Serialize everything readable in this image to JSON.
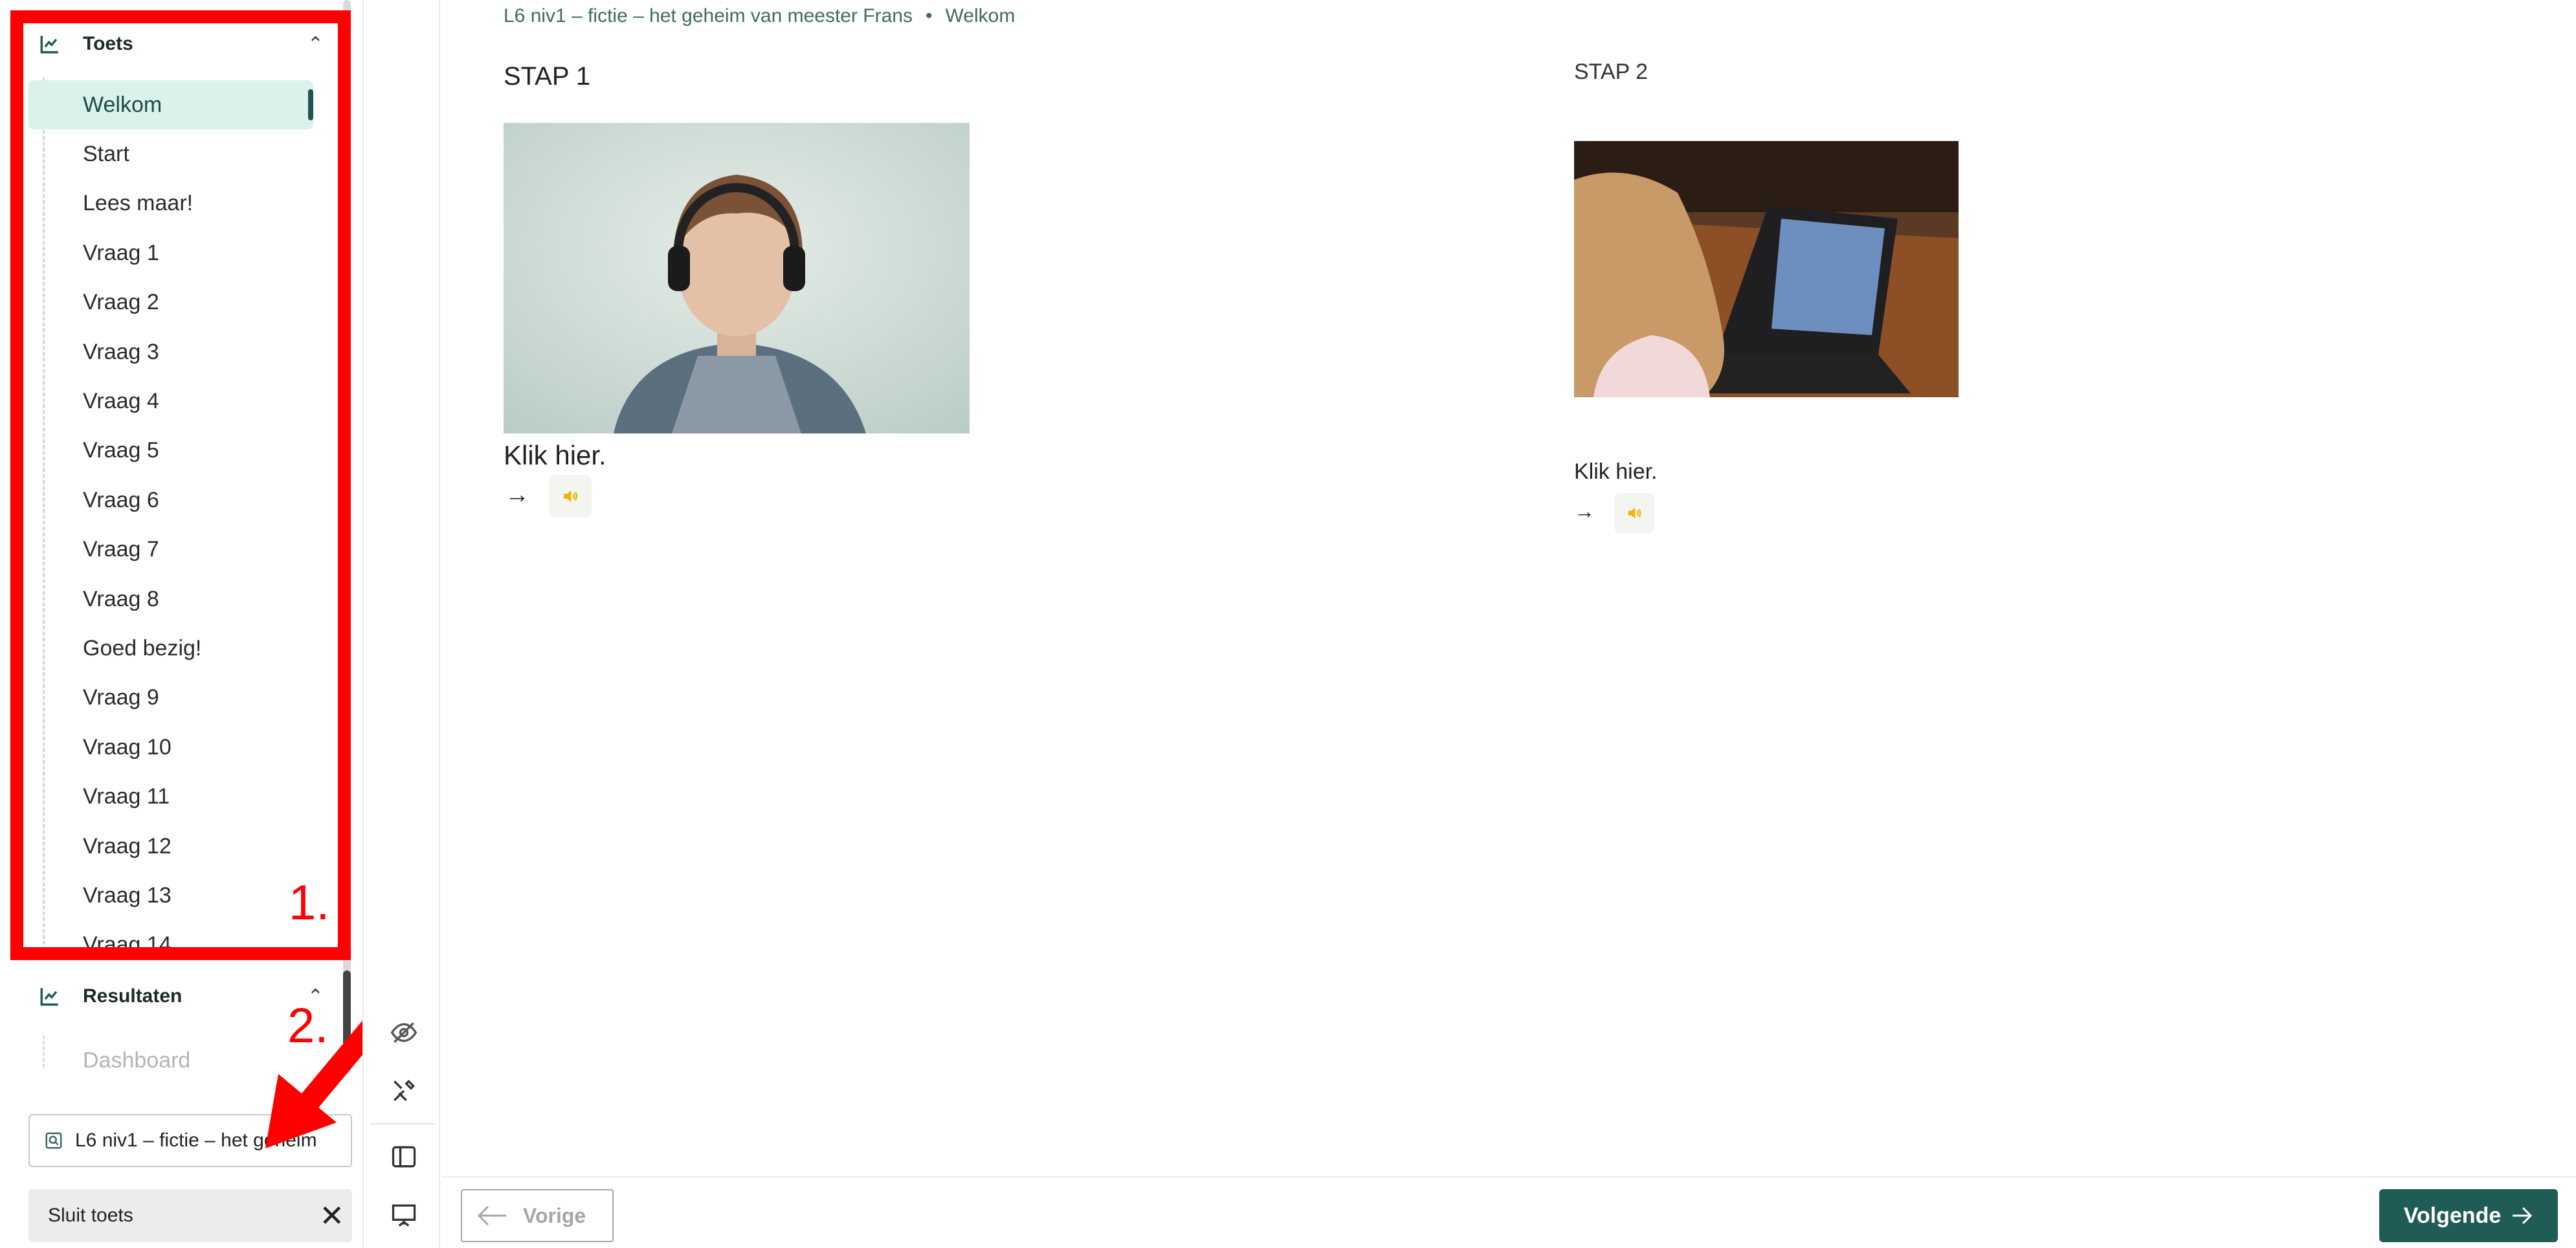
{
  "sidebar": {
    "test_section": {
      "title": "Toets",
      "icon": "chart-line-icon"
    },
    "items": [
      {
        "label": "Welkom",
        "active": true
      },
      {
        "label": "Start"
      },
      {
        "label": "Lees maar!"
      },
      {
        "label": "Vraag 1"
      },
      {
        "label": "Vraag 2"
      },
      {
        "label": "Vraag 3"
      },
      {
        "label": "Vraag 4"
      },
      {
        "label": "Vraag 5"
      },
      {
        "label": "Vraag 6"
      },
      {
        "label": "Vraag 7"
      },
      {
        "label": "Vraag 8"
      },
      {
        "label": "Goed bezig!"
      },
      {
        "label": "Vraag 9"
      },
      {
        "label": "Vraag 10"
      },
      {
        "label": "Vraag 11"
      },
      {
        "label": "Vraag 12"
      },
      {
        "label": "Vraag 13"
      },
      {
        "label": "Vraag 14"
      }
    ],
    "results_section": {
      "title": "Resultaten"
    },
    "dashboard_label": "Dashboard",
    "course_chip": "L6 niv1 – fictie – het geheim",
    "close_test": "Sluit toets"
  },
  "annotations": {
    "label_1": "1.",
    "label_2": "2."
  },
  "breadcrumb": {
    "course": "L6 niv1 – fictie – het geheim van meester Frans",
    "separator": "•",
    "page": "Welkom"
  },
  "steps": [
    {
      "title": "STAP 1",
      "click_label": "Klik hier."
    },
    {
      "title": "STAP 2",
      "click_label": "Klik hier."
    }
  ],
  "footer": {
    "prev_label": "Vorige",
    "next_label": "Volgende"
  },
  "colors": {
    "accent": "#1f5c55",
    "active_bg": "#daf1ec",
    "annotation": "#ff0000",
    "audio": "#f2b400"
  }
}
